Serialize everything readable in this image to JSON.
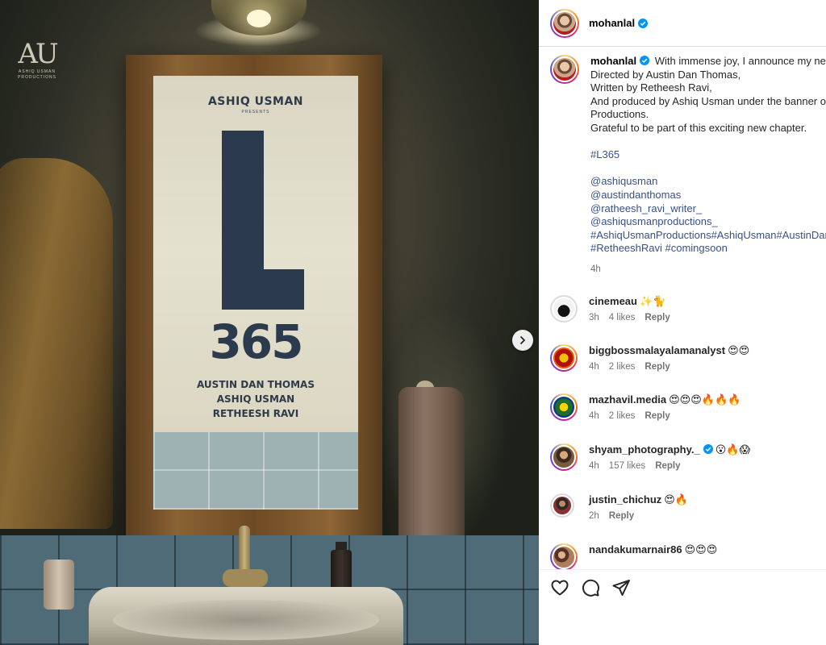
{
  "post": {
    "username": "mohanlal",
    "verified": true
  },
  "poster": {
    "logo_mark": "AU",
    "logo_sub": "ASHIQ USMAN PRODUCTIONS",
    "presenter": "ASHIQ USMAN",
    "presents": "PRESENTS",
    "title_number": "365",
    "credits": [
      "AUSTIN DAN THOMAS",
      "ASHIQ USMAN",
      "RETHEESH RAVI"
    ]
  },
  "caption": {
    "username": "mohanlal",
    "lines": [
      "With immense joy, I announce my next",
      "Directed by Austin Dan Thomas,",
      "Written by Retheesh Ravi,",
      "And produced by Ashiq Usman under the banner of Ashiq Usman",
      "Productions.",
      "Grateful to be part of this exciting new chapter."
    ],
    "hashtag": "#L365",
    "mentions": [
      "@ashiqusman",
      "@austindanthomas",
      "@ratheesh_ravi_writer_",
      "@ashiqusmanproductions_",
      "#AshiqUsmanProductions#AshiqUsman#AustinDanThomas",
      "#RetheeshRavi #comingsoon"
    ],
    "time": "4h"
  },
  "comments": [
    {
      "username": "cinemeau",
      "text": "✨🐈",
      "time": "3h",
      "likes": "4 likes",
      "reply": "Reply",
      "verified": false
    },
    {
      "username": "biggbossmalayalamanalyst",
      "text": "😍😍",
      "time": "4h",
      "likes": "2 likes",
      "reply": "Reply",
      "verified": false
    },
    {
      "username": "mazhavil.media",
      "text": "😍😍😍🔥🔥🔥",
      "time": "4h",
      "likes": "2 likes",
      "reply": "Reply",
      "verified": false
    },
    {
      "username": "shyam_photography._",
      "text": "😮🔥😱",
      "time": "4h",
      "likes": "157 likes",
      "reply": "Reply",
      "verified": true
    },
    {
      "username": "justin_chichuz",
      "text": "😍🔥",
      "time": "2h",
      "likes": "",
      "reply": "Reply",
      "verified": false
    },
    {
      "username": "nandakumarnair86",
      "text": "😍😍😍",
      "time": "",
      "likes": "",
      "reply": "",
      "verified": false
    }
  ],
  "actions": {
    "like_icon": "heart-icon",
    "comment_icon": "comment-bubble-icon",
    "share_icon": "paper-plane-icon"
  },
  "colors": {
    "link": "#385185",
    "verified": "#0095f6",
    "meta": "#737373"
  }
}
